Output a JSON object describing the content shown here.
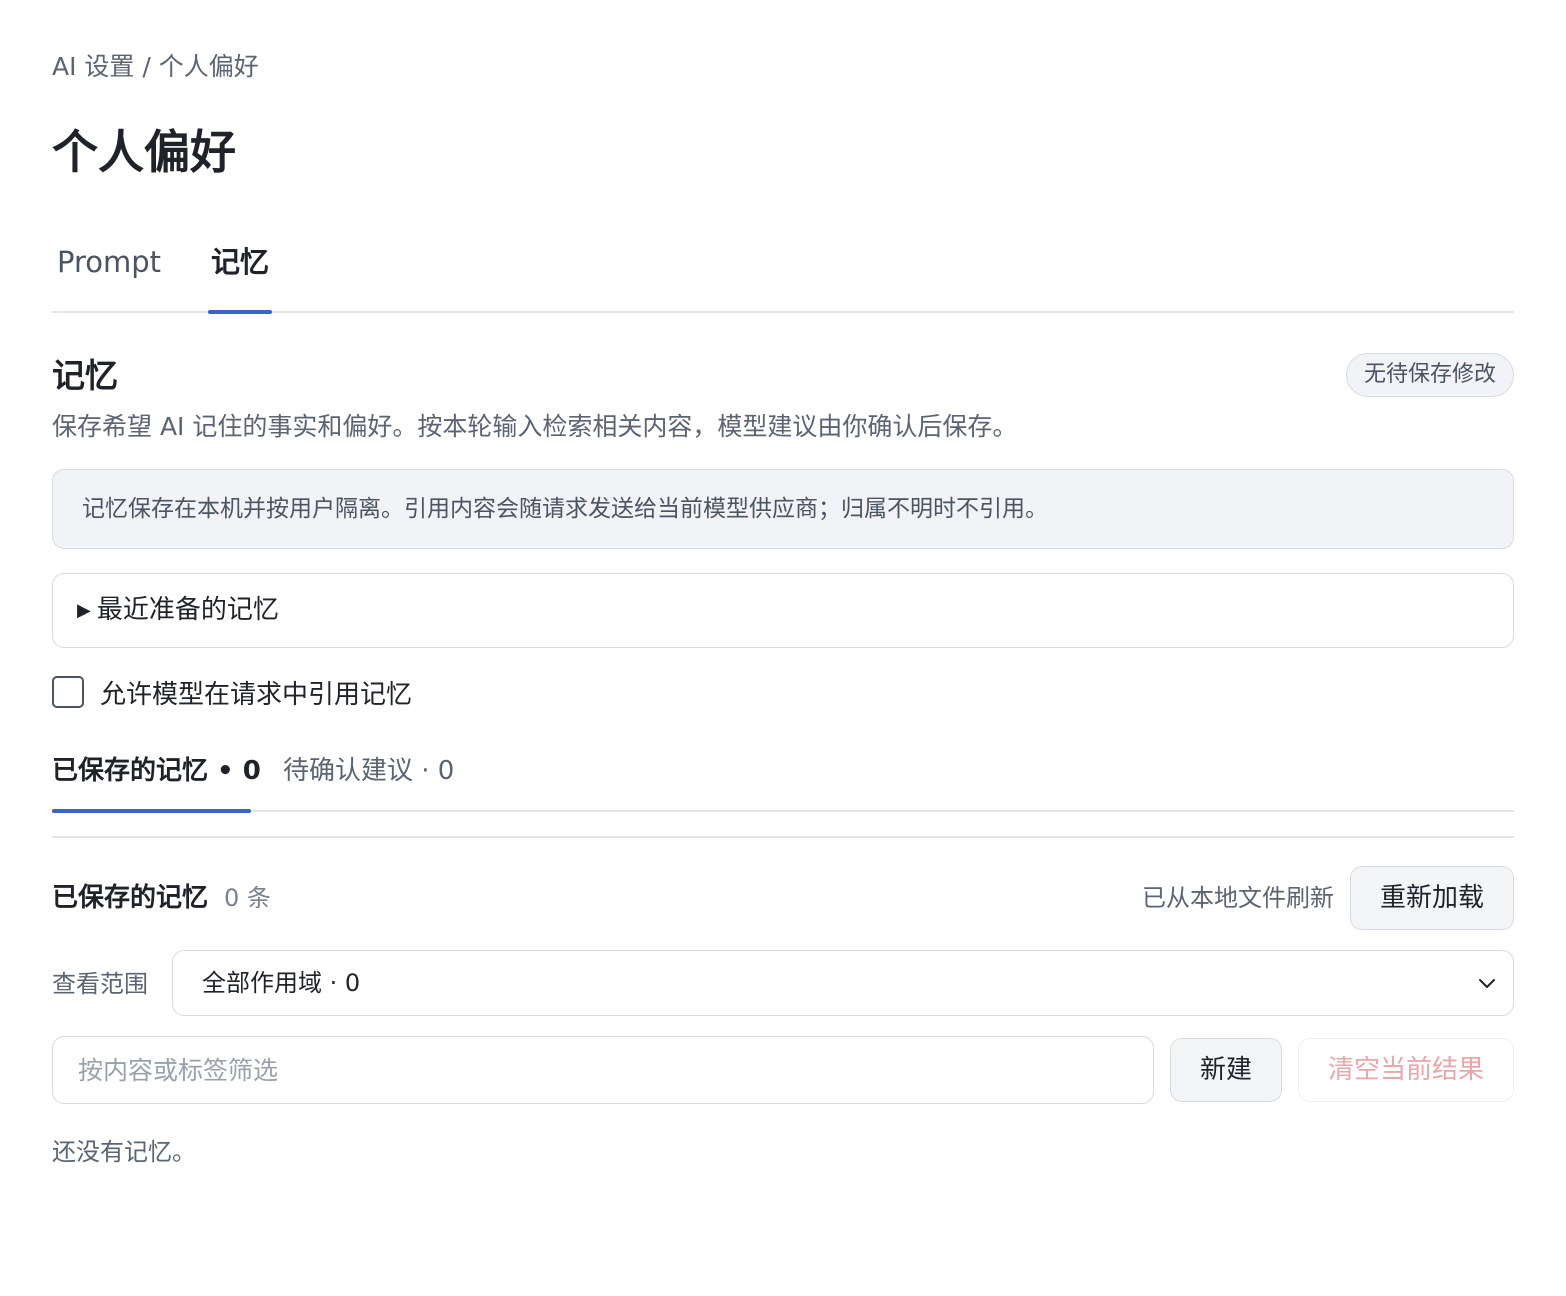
{
  "breadcrumb": "AI 设置 / 个人偏好",
  "page_title": "个人偏好",
  "top_tabs": [
    {
      "label": "Prompt",
      "active": false
    },
    {
      "label": "记忆",
      "active": true
    }
  ],
  "memory_section": {
    "title": "记忆",
    "status_badge": "无待保存修改",
    "description": "保存希望 AI 记住的事实和偏好。按本轮输入检索相关内容，模型建议由你确认后保存。",
    "info_text": "记忆保存在本机并按用户隔离。引用内容会随请求发送给当前模型供应商；归属不明时不引用。",
    "recent_label": "最近准备的记忆",
    "allow_checkbox": {
      "label": "允许模型在请求中引用记忆",
      "checked": false
    }
  },
  "sub_tabs": [
    {
      "label": "已保存的记忆 • 0",
      "active": true
    },
    {
      "label": "待确认建议 · 0",
      "active": false
    }
  ],
  "saved": {
    "title": "已保存的记忆",
    "count": "0 条",
    "refresh_status": "已从本地文件刷新",
    "reload_label": "重新加载",
    "scope_label": "查看范围",
    "scope_value": "全部作用域 · 0",
    "filter_placeholder": "按内容或标签筛选",
    "filter_value": "",
    "new_label": "新建",
    "clear_label": "清空当前结果",
    "empty_text": "还没有记忆。"
  },
  "colors": {
    "accent": "#3c63c9",
    "disabled_danger_text": "#eaa6aa",
    "info_bg": "#f1f3f6"
  }
}
